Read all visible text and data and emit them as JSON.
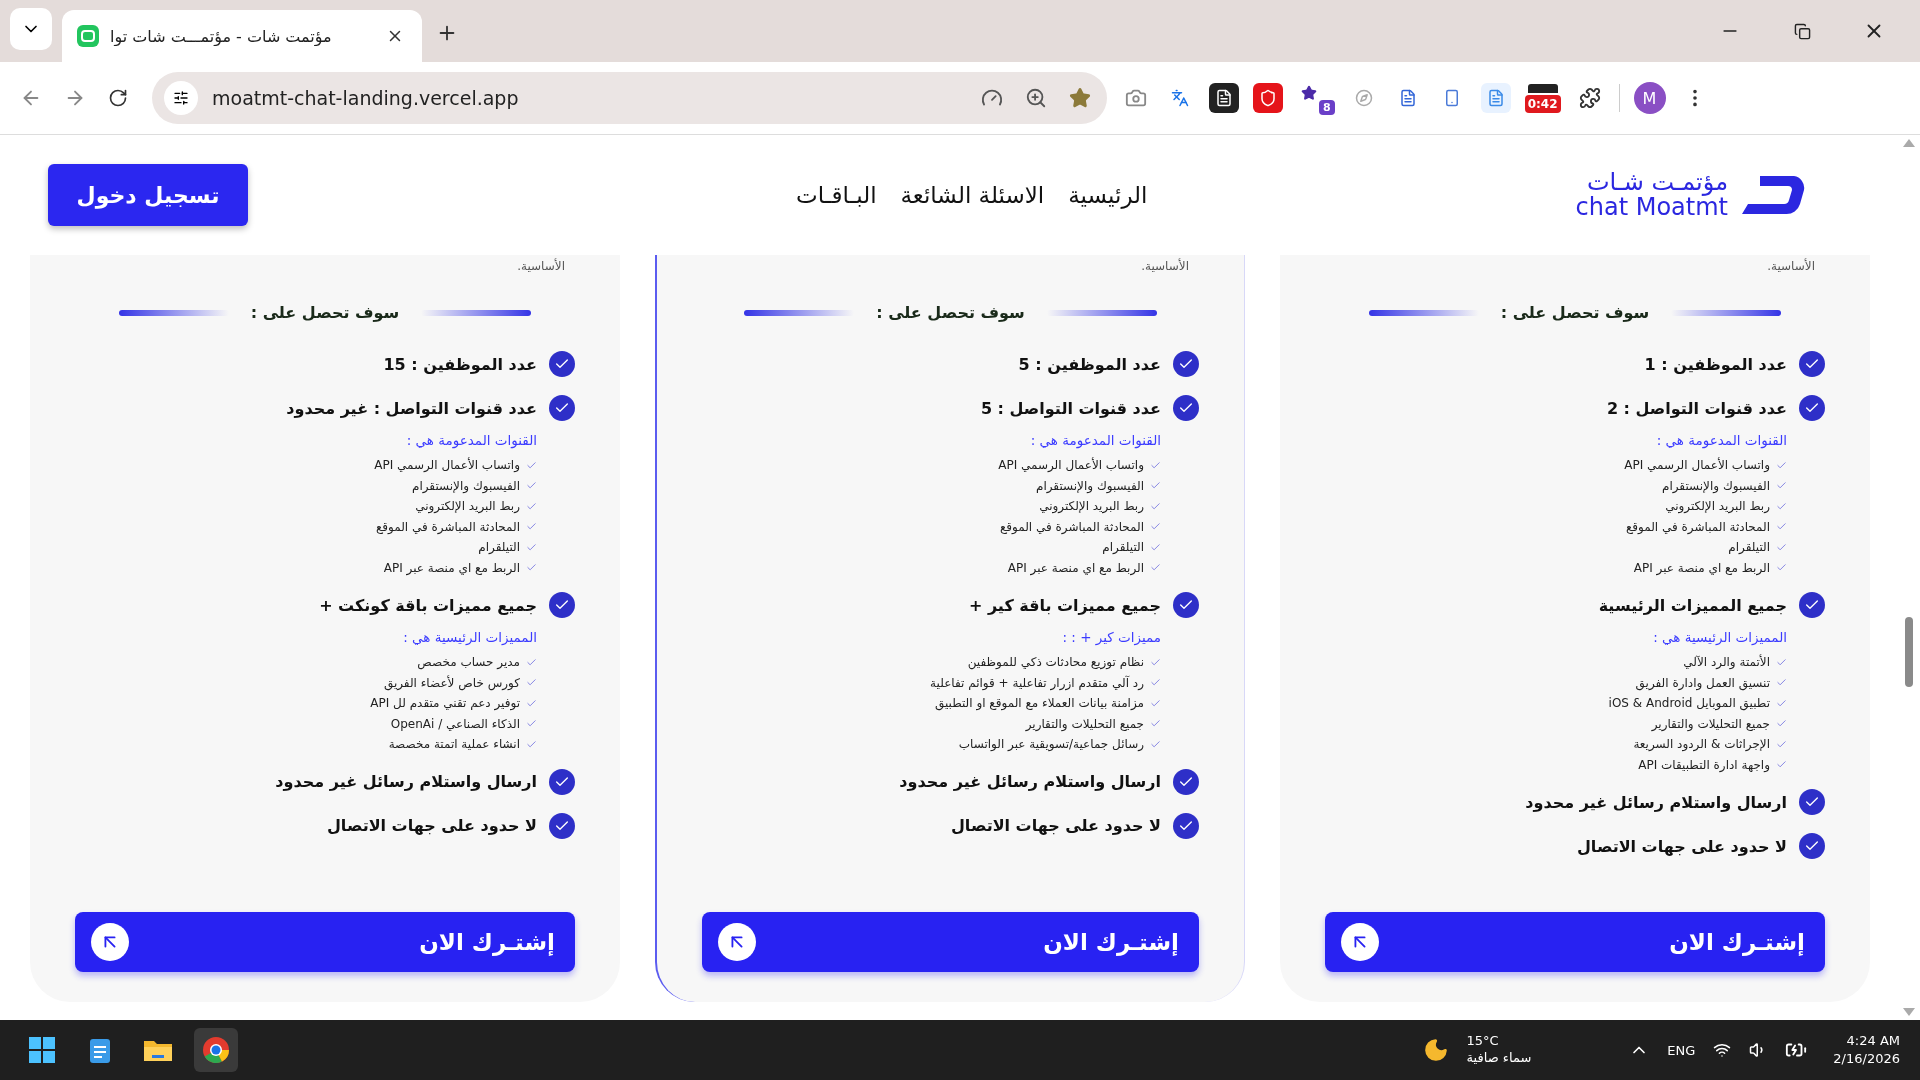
{
  "browser": {
    "tab_title": "مؤتمت شات - مؤتمـــت شات توا",
    "url": "moatmt-chat-landing.vercel.app",
    "extension_badge": "8",
    "timer_badge": "0:42",
    "profile_initial": "M"
  },
  "header": {
    "logo_arabic": "مؤتمـت شـات",
    "logo_latin": "chat Moatmt",
    "nav": [
      {
        "label": "الرئيسية"
      },
      {
        "label": "الاسئلة الشائعة"
      },
      {
        "label": "البـاقـات"
      }
    ],
    "login_button": "تسجيل دخول"
  },
  "plans": [
    {
      "featured": false,
      "note": "الأساسية.",
      "divider_title": "سوف تحصل على :",
      "features": [
        {
          "kind": "main",
          "text": "عدد الموظفين : 1"
        },
        {
          "kind": "main",
          "text": "عدد قنوات التواصل : 2"
        },
        {
          "kind": "group",
          "title": "القنوات المدعومة هي :",
          "items": [
            "واتساب الأعمال الرسمي API",
            "الفيسبوك والإنستقرام",
            "ربط البريد الإلكتروني",
            "المحادثة المباشرة في الموقع",
            "التيلقرام",
            "الربط مع اي منصة عبر API"
          ]
        },
        {
          "kind": "main",
          "text": "جميع المميزات الرئيسية"
        },
        {
          "kind": "group",
          "title": "المميزات الرئيسية هي :",
          "items": [
            "الأتمتة والرد الآلي",
            "تنسيق العمل وادارة الفريق",
            "تطبيق الموبايل iOS & Android",
            "جميع التحليلات والتقارير",
            "الإجراثات & الردود السريعة",
            "واجهة ادارة التطبيقات API"
          ]
        },
        {
          "kind": "main",
          "text": "ارسال واستلام رسائل غير محدود"
        },
        {
          "kind": "main",
          "text": "لا حدود على جهات الاتصال"
        }
      ],
      "subscribe_button": "إشتـرك الان"
    },
    {
      "featured": true,
      "note": "الأساسية.",
      "divider_title": "سوف تحصل على :",
      "features": [
        {
          "kind": "main",
          "text": "عدد الموظفين : 5"
        },
        {
          "kind": "main",
          "text": "عدد قنوات التواصل : 5"
        },
        {
          "kind": "group",
          "title": "القنوات المدعومة هي :",
          "items": [
            "واتساب الأعمال الرسمي API",
            "الفيسبوك والإنستقرام",
            "ربط البريد الإلكتروني",
            "المحادثة المباشرة في الموقع",
            "التيلقرام",
            "الربط مع اي منصة عبر API"
          ]
        },
        {
          "kind": "main",
          "text": "جميع مميزات باقة كير +"
        },
        {
          "kind": "group",
          "title": "مميزات كير + : :",
          "items": [
            "نظام توزيع محادثات ذكي للموظفين",
            "رد آلي متقدم ازرار تفاعلية + قوائم تفاعلية",
            "مزامنة بيانات العملاء مع الموقع او التطبيق",
            "جميع التحليلات والتقارير",
            "رسائل جماعية/تسويقية عبر الواتساب"
          ]
        },
        {
          "kind": "main",
          "text": "ارسال واستلام رسائل غير محدود"
        },
        {
          "kind": "main",
          "text": "لا حدود على جهات الاتصال"
        }
      ],
      "subscribe_button": "إشتـرك الان"
    },
    {
      "featured": false,
      "note": "الأساسية.",
      "divider_title": "سوف تحصل على :",
      "features": [
        {
          "kind": "main",
          "text": "عدد الموظفين : 15"
        },
        {
          "kind": "main",
          "text": "عدد قنوات التواصل : غير محدود"
        },
        {
          "kind": "group",
          "title": "القنوات المدعومة هي :",
          "items": [
            "واتساب الأعمال الرسمي API",
            "الفيسبوك والإنستقرام",
            "ربط البريد الإلكتروني",
            "المحادثة المباشرة في الموقع",
            "التيلقرام",
            "الربط مع اي منصة عبر API"
          ]
        },
        {
          "kind": "main",
          "text": "جميع مميزات باقة كونكت +"
        },
        {
          "kind": "group",
          "title": "المميزات الرئيسية هي :",
          "items": [
            "مدير حساب مخصص",
            "كورس خاص لأعضاء الفريق",
            "توفير دعم تقني متقدم لل API",
            "الذكاء الصناعي / OpenAi",
            "انشاء عملية اتمتة مخصصة"
          ]
        },
        {
          "kind": "main",
          "text": "ارسال واستلام رسائل غير محدود"
        },
        {
          "kind": "main",
          "text": "لا حدود على جهات الاتصال"
        }
      ],
      "subscribe_button": "إشتـرك الان"
    }
  ],
  "taskbar": {
    "temperature": "15°C",
    "weather": "سماء صافية",
    "language": "ENG",
    "time": "4:24 AM",
    "date": "2/16/2026"
  }
}
